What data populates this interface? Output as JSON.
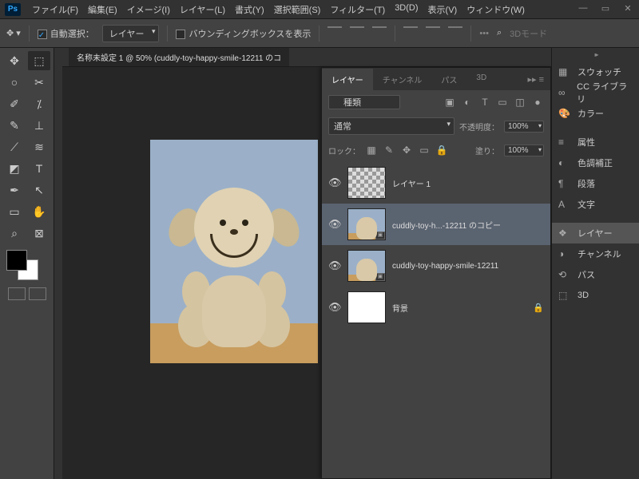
{
  "app": {
    "logo": "Ps"
  },
  "menu": [
    "ファイル(F)",
    "編集(E)",
    "イメージ(I)",
    "レイヤー(L)",
    "書式(Y)",
    "選択範囲(S)",
    "フィルター(T)",
    "3D(D)",
    "表示(V)",
    "ウィンドウ(W)"
  ],
  "options": {
    "autoSelectLabel": "自動選択：",
    "autoSelectValue": "レイヤー",
    "boundingBox": "バウンディングボックスを表示",
    "searchPlaceholder": "3Dモード",
    "searchIcon": "⌕"
  },
  "document": {
    "tab": "名称未設定 1 @ 50% (cuddly-toy-happy-smile-12211 のコ"
  },
  "layersPanel": {
    "tabs": [
      "レイヤー",
      "チャンネル",
      "パス",
      "3D"
    ],
    "filterLabel": "種類",
    "blend": "通常",
    "opacityLabel": "不透明度：",
    "opacityValue": "100%",
    "lockLabel": "ロック：",
    "fillLabel": "塗り：",
    "fillValue": "100%",
    "layers": [
      {
        "name": "レイヤー 1",
        "thumbClass": "trans",
        "smart": false
      },
      {
        "name": "cuddly-toy-h...-12211 のコピー",
        "thumbClass": "",
        "smart": true,
        "selected": true
      },
      {
        "name": "cuddly-toy-happy-smile-12211",
        "thumbClass": "",
        "smart": true
      },
      {
        "name": "背景",
        "thumbClass": "white",
        "locked": true
      }
    ]
  },
  "rightPanels": [
    {
      "icon": "▦",
      "label": "スウォッチ"
    },
    {
      "icon": "∞",
      "label": "CC ライブラリ"
    },
    {
      "icon": "🎨",
      "label": "カラー"
    },
    {
      "gap": true
    },
    {
      "icon": "≡",
      "label": "属性"
    },
    {
      "icon": "◐",
      "label": "色調補正"
    },
    {
      "icon": "¶",
      "label": "段落"
    },
    {
      "icon": "A",
      "label": "文字"
    },
    {
      "gap": true
    },
    {
      "icon": "❖",
      "label": "レイヤー",
      "active": true
    },
    {
      "icon": "◑",
      "label": "チャンネル"
    },
    {
      "icon": "⟲",
      "label": "パス"
    },
    {
      "icon": "⬚",
      "label": "3D"
    }
  ],
  "tools": [
    "✥",
    "⬚",
    "○",
    "✂",
    "✐",
    "⁒",
    "✎",
    "⊥",
    "⟋",
    "≋",
    "◩",
    "T",
    "✒",
    "↖",
    "▭",
    "✋",
    "⌕",
    "⊠"
  ],
  "chart_data": null
}
